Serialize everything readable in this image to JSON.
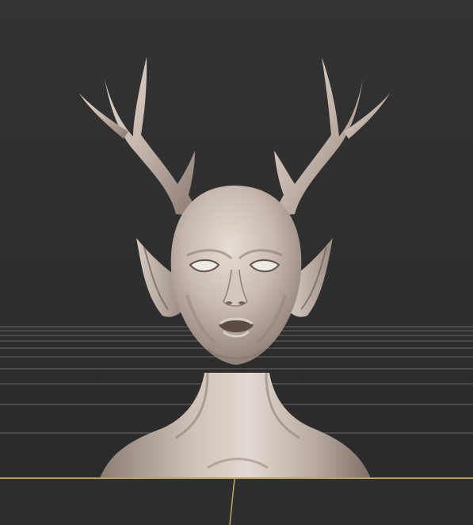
{
  "viewport": {
    "background": "#2e2e2e",
    "grid_color": "#8a8a8a",
    "axis_color": "#b5a25e",
    "sculpt_color": "#bcaea4",
    "sculpt_shadow": "#7a6c64",
    "sculpt_highlight": "#e4dcd5",
    "model": "antlered-elf-bust",
    "grid_visible": true
  }
}
